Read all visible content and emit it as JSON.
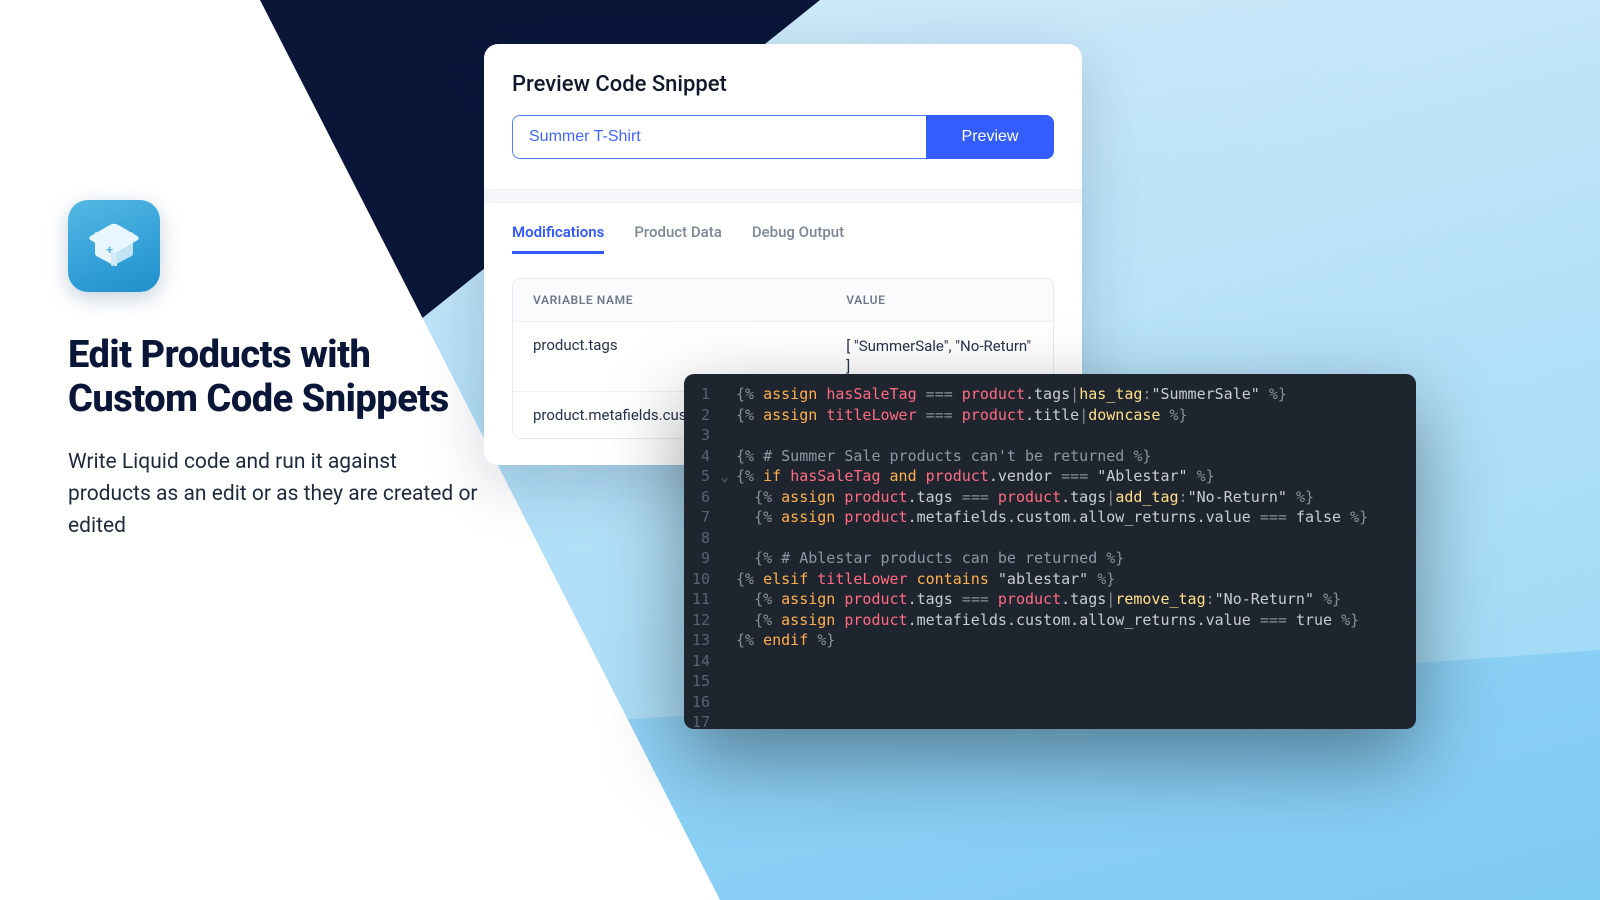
{
  "headline": "Edit Products with Custom Code Snippets",
  "sub": "Write Liquid code and run it against products as an edit or as they are created or edited",
  "card": {
    "title": "Preview Code Snippet",
    "input_value": "Summer T-Shirt",
    "preview_button": "Preview",
    "tabs": [
      "Modifications",
      "Product Data",
      "Debug Output"
    ],
    "active_tab": 0,
    "columns": {
      "variable": "VARIABLE NAME",
      "value": "VALUE"
    },
    "rows": [
      {
        "name": "product.tags",
        "value": "[ \"SummerSale\", \"No-Return\" ]"
      },
      {
        "name": "product.metafields.custom",
        "value": ""
      }
    ]
  },
  "code_lines": [
    "{% assign hasSaleTag = product.tags|has_tag:\"SummerSale\" %}",
    "{% assign titleLower = product.title|downcase %}",
    "",
    "{% # Summer Sale products can't be returned %}",
    "{% if hasSaleTag and product.vendor = \"Ablestar\" %}",
    "  {% assign product.tags = product.tags|add_tag:\"No-Return\" %}",
    "  {% assign product.metafields.custom.allow_returns.value = false %}",
    "",
    "  {% # Ablestar products can be returned %}",
    "{% elsif titleLower contains \"ablestar\" %}",
    "  {% assign product.tags = product.tags|remove_tag:\"No-Return\" %}",
    "  {% assign product.metafields.custom.allow_returns.value = true %}",
    "{% endif %}",
    "",
    "",
    "",
    ""
  ],
  "gutter_fold_line": 5
}
